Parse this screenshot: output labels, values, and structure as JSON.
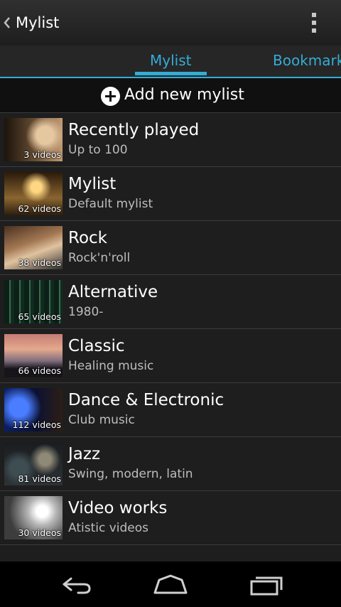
{
  "actionbar": {
    "title": "Mylist",
    "back_icon": "chevron-left-icon",
    "overflow_icon": "overflow-menu-icon"
  },
  "tabs": [
    {
      "label": "Mylist",
      "active": true
    },
    {
      "label": "Bookmark",
      "active": false
    }
  ],
  "add_new": {
    "icon": "add-circle-icon",
    "label": "Add new mylist"
  },
  "mylists": [
    {
      "title": "Recently played",
      "subtitle": "Up to 100",
      "count": "3 videos"
    },
    {
      "title": "Mylist",
      "subtitle": "Default mylist",
      "count": "62 videos"
    },
    {
      "title": "Rock",
      "subtitle": "Rock'n'roll",
      "count": "38 videos"
    },
    {
      "title": "Alternative",
      "subtitle": "1980-",
      "count": "65 videos"
    },
    {
      "title": "Classic",
      "subtitle": "Healing music",
      "count": "66 videos"
    },
    {
      "title": "Dance & Electronic",
      "subtitle": "Club music",
      "count": "112 videos"
    },
    {
      "title": "Jazz",
      "subtitle": "Swing, modern, latin",
      "count": "81 videos"
    },
    {
      "title": "Video works",
      "subtitle": "Atistic videos",
      "count": "30 videos"
    }
  ],
  "navbar": {
    "back_icon": "nav-back-icon",
    "home_icon": "nav-home-icon",
    "recents_icon": "nav-recents-icon"
  },
  "colors": {
    "accent": "#34acd6",
    "background": "#1e1e1e",
    "navbar": "#000000"
  }
}
